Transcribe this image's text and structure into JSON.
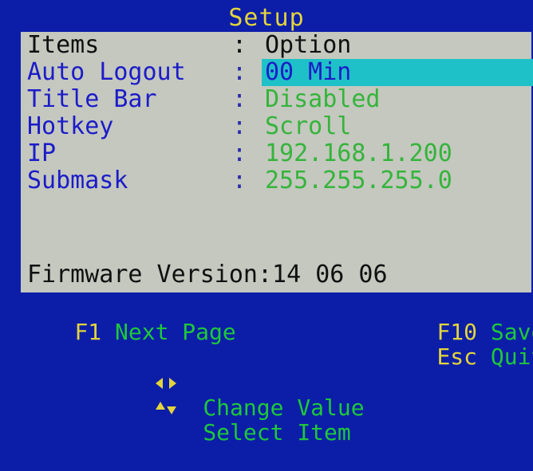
{
  "title": "Setup",
  "header": {
    "label": "Items",
    "separator": ":",
    "value": "Option"
  },
  "items": [
    {
      "label": "Auto Logout",
      "value": "00 Min"
    },
    {
      "label": "Title Bar",
      "value": "Disabled"
    },
    {
      "label": "Hotkey",
      "value": "Scroll"
    },
    {
      "label": "IP",
      "value": "192.168.1.200"
    },
    {
      "label": "Submask",
      "value": "255.255.255.0"
    }
  ],
  "selected_index": 0,
  "firmware": "Firmware Version:14 06 06",
  "help": {
    "f1_key": "F1",
    "f1_desc": "Next Page",
    "f10_key": "F10",
    "f10_desc": "Save",
    "change_icon": "left-right-arrows-icon",
    "change_desc": "Change Value",
    "esc_key": "Esc",
    "esc_desc": "Quit",
    "select_icon": "up-down-arrows-icon",
    "select_desc": "Select Item"
  },
  "colors": {
    "background": "#0c1ea8",
    "panel": "#c4c8bf",
    "title": "#e3d43c",
    "label": "#1c1cc8",
    "value": "#35b43b",
    "highlight": "#1ec1c8"
  }
}
